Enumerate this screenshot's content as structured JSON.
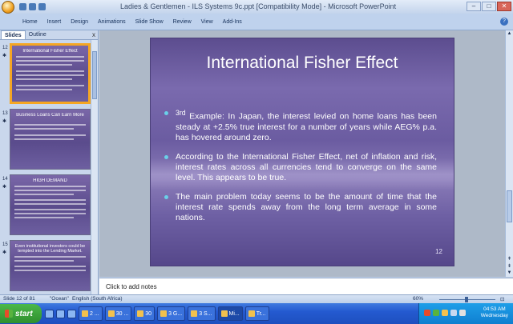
{
  "window": {
    "title": "Ladies & Gentlemen - ILS Systems 9c.ppt [Compatibility Mode] - Microsoft PowerPoint",
    "minimize": "–",
    "maximize": "□",
    "close": "✕"
  },
  "ribbon": {
    "tabs": [
      "Home",
      "Insert",
      "Design",
      "Animations",
      "Slide Show",
      "Review",
      "View",
      "Add-Ins"
    ],
    "help": "?"
  },
  "panel": {
    "tabs": [
      "Slides",
      "Outline"
    ],
    "close": "x",
    "thumbnails": [
      {
        "number": "12",
        "title": "International Fisher Effect",
        "selected": true
      },
      {
        "number": "13",
        "title": "Business Loans Can Earn More",
        "selected": false
      },
      {
        "number": "14",
        "title": "HIGH  DEMAND",
        "selected": false
      },
      {
        "number": "15",
        "title": "Even institutional investors could be tempted into the Lending Market.",
        "selected": false
      }
    ]
  },
  "slide": {
    "title": "International Fisher Effect",
    "bullets": [
      {
        "sup": "3rd",
        "text": " Example: In Japan, the interest levied on home loans has been steady at +2.5% true interest for a number of years while AEG% p.a. has hovered around zero."
      },
      {
        "sup": "",
        "text": "According to the International Fisher Effect, net of inflation and risk, interest rates across all currencies tend to converge on the same level. This appears to be true."
      },
      {
        "sup": "",
        "text": "The main problem today seems to be the amount of time that the interest rate spends away from the long term average in some nations."
      }
    ],
    "number": "12"
  },
  "notes": {
    "placeholder": "Click to add notes"
  },
  "status": {
    "slide_info": "Slide 12 of 81",
    "theme": "\"Ocean\"",
    "language": "English (South Africa)",
    "zoom": "60%"
  },
  "taskbar": {
    "start": "start",
    "tasks": [
      {
        "label": "2 ..."
      },
      {
        "label": "30 ..."
      },
      {
        "label": "30"
      },
      {
        "label": "3 G..."
      },
      {
        "label": "3 S..."
      },
      {
        "label": "Mi..."
      },
      {
        "label": "Tr..."
      }
    ],
    "clock_time": "04:53 AM",
    "clock_day": "Wednesday"
  },
  "colors": {
    "bullet": "#6ad0e8",
    "selection": "#f5a623",
    "taskbar": "#245ad0"
  }
}
